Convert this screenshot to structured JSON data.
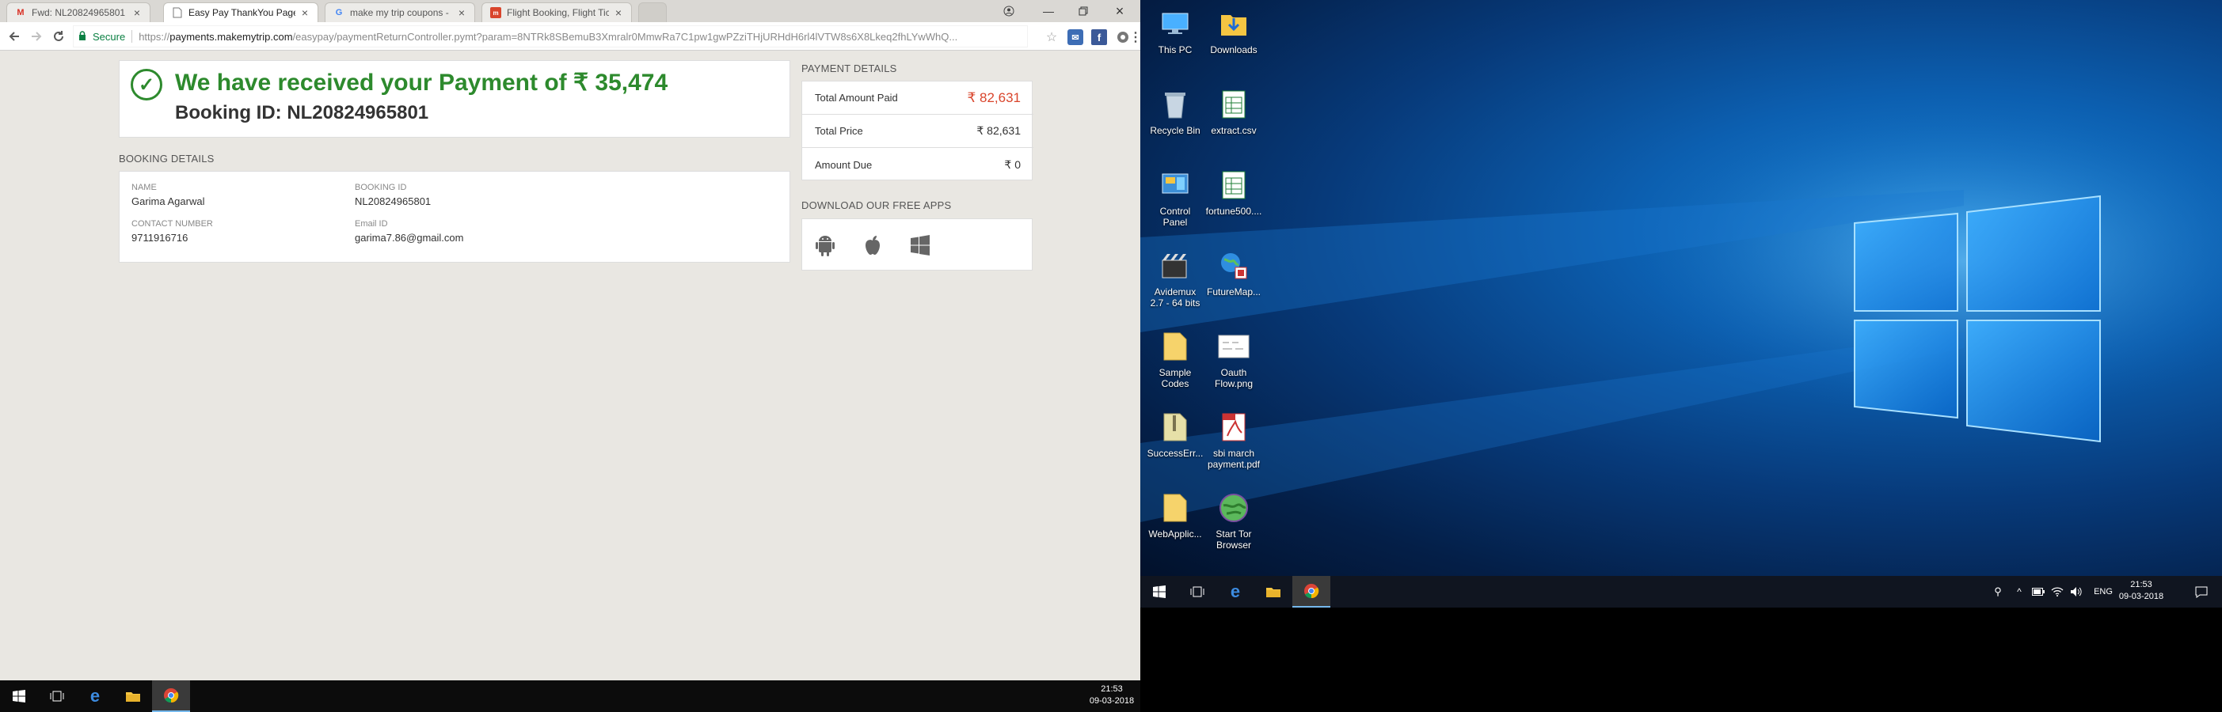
{
  "browser": {
    "tabs": [
      {
        "title": "Fwd: NL20824965801 - ",
        "favicon": "gmail-icon",
        "active": false
      },
      {
        "title": "Easy Pay ThankYou Page",
        "favicon": "page-icon",
        "active": true
      },
      {
        "title": "make my trip coupons - ",
        "favicon": "google-icon",
        "active": false
      },
      {
        "title": "Flight Booking, Flight Tic",
        "favicon": "mmt-icon",
        "active": false
      }
    ],
    "omnibox": {
      "secure_label": "Secure",
      "url_scheme": "https://",
      "url_host": "payments.makemytrip.com",
      "url_path": "/easypay/paymentReturnController.pymt?param=8NTRk8SBemuB3Xmralr0MmwRa7C1pw1gwPZziTHjURHdH6rl4lVTW8s6X8Lkeq2fhLYwWhQ..."
    }
  },
  "page": {
    "received_text": "We have received your Payment of ₹ 35,474",
    "booking_id_line": "Booking ID: NL20824965801",
    "booking_details_heading": "BOOKING DETAILS",
    "booking": {
      "name_label": "NAME",
      "name_value": "Garima Agarwal",
      "booking_id_label": "BOOKING ID",
      "booking_id_value": "NL20824965801",
      "contact_label": "CONTACT NUMBER",
      "contact_value": "9711916716",
      "email_label": "Email ID",
      "email_value": "garima7.86@gmail.com"
    },
    "payment_details_heading": "PAYMENT DETAILS",
    "payment": {
      "total_paid_label": "Total Amount Paid",
      "total_paid_value": "₹ 82,631",
      "total_price_label": "Total Price",
      "total_price_value": "₹ 82,631",
      "amount_due_label": "Amount Due",
      "amount_due_value": "₹ 0"
    },
    "apps_heading": "DOWNLOAD OUR FREE APPS",
    "apps": [
      "android-icon",
      "apple-icon",
      "windows-icon"
    ]
  },
  "taskbar_left": {
    "time": "21:53",
    "date": "09-03-2018"
  },
  "desktop": {
    "icons_col1": [
      "This PC",
      "Recycle Bin",
      "Control Panel",
      "Avidemux 2.7 - 64 bits",
      "Sample Codes",
      "SuccessErr...",
      "WebApplic..."
    ],
    "icons_col2": [
      "Downloads",
      "extract.csv",
      "fortune500....",
      "FutureMap...",
      "Oauth Flow.png",
      "sbi march payment.pdf",
      "Start Tor Browser"
    ]
  },
  "taskbar_right": {
    "language": "ENG",
    "time": "21:53",
    "date": "09-03-2018"
  },
  "colors": {
    "success_green": "#2d8a2d",
    "amount_red": "#d9452c",
    "secure_green": "#0b8043"
  }
}
